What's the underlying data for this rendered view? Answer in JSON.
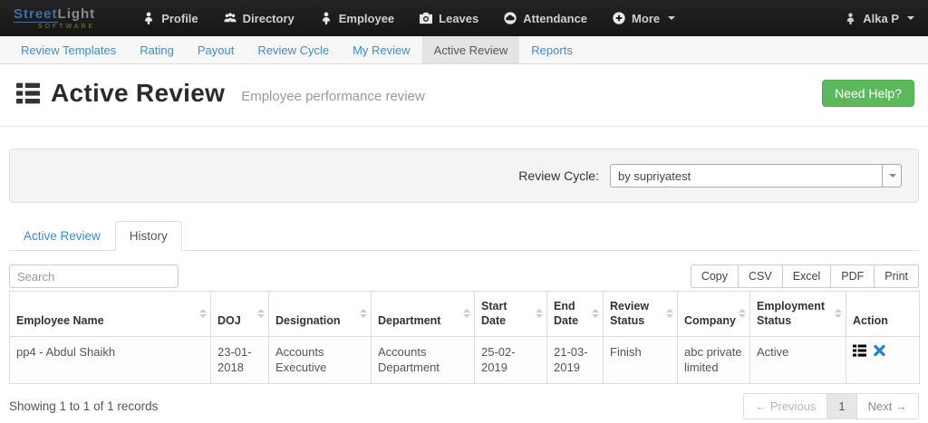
{
  "colors": {
    "link_blue": "#3c8dce",
    "help_green": "#5cb85c",
    "action_icon_blue": "#2386c8",
    "navbar_dark": "#1d1d1d"
  },
  "topnav": {
    "logo": {
      "part1": "Street",
      "part2": "Light",
      "tagline": "SOFTWARE"
    },
    "items": [
      {
        "label": "Profile",
        "icon": "user-icon"
      },
      {
        "label": "Directory",
        "icon": "users-icon"
      },
      {
        "label": "Employee",
        "icon": "user-icon"
      },
      {
        "label": "Leaves",
        "icon": "camera-icon"
      },
      {
        "label": "Attendance",
        "icon": "cloud-circle-icon"
      },
      {
        "label": "More",
        "icon": "plus-circle-icon",
        "caret": true
      }
    ],
    "user": {
      "label": "Alka P",
      "icon": "user-icon"
    }
  },
  "subnav": {
    "items": [
      {
        "label": "Review Templates",
        "active": false
      },
      {
        "label": "Rating",
        "active": false
      },
      {
        "label": "Payout",
        "active": false
      },
      {
        "label": "Review Cycle",
        "active": false
      },
      {
        "label": "My Review",
        "active": false
      },
      {
        "label": "Active Review",
        "active": true
      },
      {
        "label": "Reports",
        "active": false
      }
    ]
  },
  "header": {
    "title": "Active Review",
    "subtitle": "Employee performance review",
    "help_button_label": "Need Help?"
  },
  "filter": {
    "label": "Review Cycle:",
    "selected_option": "by supriyatest"
  },
  "tabs": [
    {
      "label": "Active Review",
      "active": false
    },
    {
      "label": "History",
      "active": true
    }
  ],
  "toolbar": {
    "search_placeholder": "Search",
    "export_buttons": [
      "Copy",
      "CSV",
      "Excel",
      "PDF",
      "Print"
    ]
  },
  "table": {
    "columns": [
      {
        "label": "Employee Name",
        "sortable": true
      },
      {
        "label": "DOJ",
        "sortable": true
      },
      {
        "label": "Designation",
        "sortable": true
      },
      {
        "label": "Department",
        "sortable": true
      },
      {
        "label": "Start Date",
        "sortable": true
      },
      {
        "label": "End Date",
        "sortable": true
      },
      {
        "label": "Review Status",
        "sortable": true
      },
      {
        "label": "Company",
        "sortable": true
      },
      {
        "label": "Employment Status",
        "sortable": true
      },
      {
        "label": "Action",
        "sortable": false
      }
    ],
    "rows": [
      {
        "cells": [
          "pp4 - Abdul Shaikh",
          "23-01-2018",
          "Accounts Executive",
          "Accounts Department",
          "25-02-2019",
          "21-03-2019",
          "Finish",
          "abc private limited",
          "Active"
        ],
        "actions": [
          {
            "icon": "view-list-icon"
          },
          {
            "icon": "delete-x-icon"
          }
        ]
      }
    ]
  },
  "footer": {
    "summary": "Showing 1 to 1 of 1 records",
    "pagination": {
      "prev": "← Previous",
      "page": "1",
      "next": "Next →"
    }
  }
}
